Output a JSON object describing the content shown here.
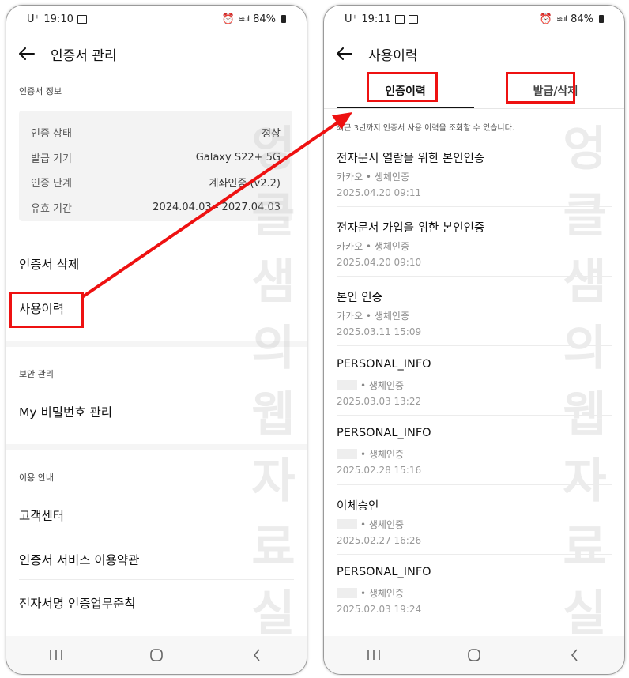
{
  "colors": {
    "annotation_red": "#ee1111",
    "card_bg": "#f3f3f3"
  },
  "left": {
    "status": {
      "carrier": "U⁺",
      "time": "19:10",
      "battery": "84%"
    },
    "header": {
      "title": "인증서 관리"
    },
    "info_section_title": "인증서 정보",
    "info_rows": [
      {
        "label": "인증 상태",
        "value": "정상"
      },
      {
        "label": "발급 기기",
        "value": "Galaxy S22+ 5G"
      },
      {
        "label": "인증 단계",
        "value": "계좌인증 (v2.2)"
      },
      {
        "label": "유효 기간",
        "value": "2024.04.03 - 2027.04.03"
      }
    ],
    "menu": {
      "delete": "인증서 삭제",
      "history": "사용이력"
    },
    "security_section_title": "보안 관리",
    "password_menu": "My 비밀번호 관리",
    "usage_section_title": "이용 안내",
    "support": [
      "고객센터",
      "인증서 서비스 이용약관",
      "전자서명 인증업무준칙"
    ],
    "watermark": "엉클샘의웹자료실"
  },
  "right": {
    "status": {
      "carrier": "U⁺",
      "time": "19:11",
      "battery": "84%"
    },
    "header": {
      "title": "사용이력"
    },
    "tabs": {
      "history": "인증이력",
      "issue_delete": "발급/삭제"
    },
    "notice": "최근 3년까지 인증서 사용 이력을 조회할 수 있습니다.",
    "items": [
      {
        "title": "전자문서 열람을 위한 본인인증",
        "sub": "카카오 • 생체인증",
        "time": "2025.04.20 09:11",
        "masked": false
      },
      {
        "title": "전자문서 가입을 위한 본인인증",
        "sub": "카카오 • 생체인증",
        "time": "2025.04.20 09:10",
        "masked": false
      },
      {
        "title": "본인 인증",
        "sub": "카카오 • 생체인증",
        "time": "2025.03.11 15:09",
        "masked": false
      },
      {
        "title": "PERSONAL_INFO",
        "sub": "• 생체인증",
        "time": "2025.03.03 13:22",
        "masked": true
      },
      {
        "title": "PERSONAL_INFO",
        "sub": "• 생체인증",
        "time": "2025.02.28 15:16",
        "masked": true
      },
      {
        "title": "이체승인",
        "sub": "• 생체인증",
        "time": "2025.02.27 16:26",
        "masked": true
      },
      {
        "title": "PERSONAL_INFO",
        "sub": "• 생체인증",
        "time": "2025.02.03 19:24",
        "masked": true
      }
    ],
    "watermark": "엉클샘의웹자료실"
  }
}
